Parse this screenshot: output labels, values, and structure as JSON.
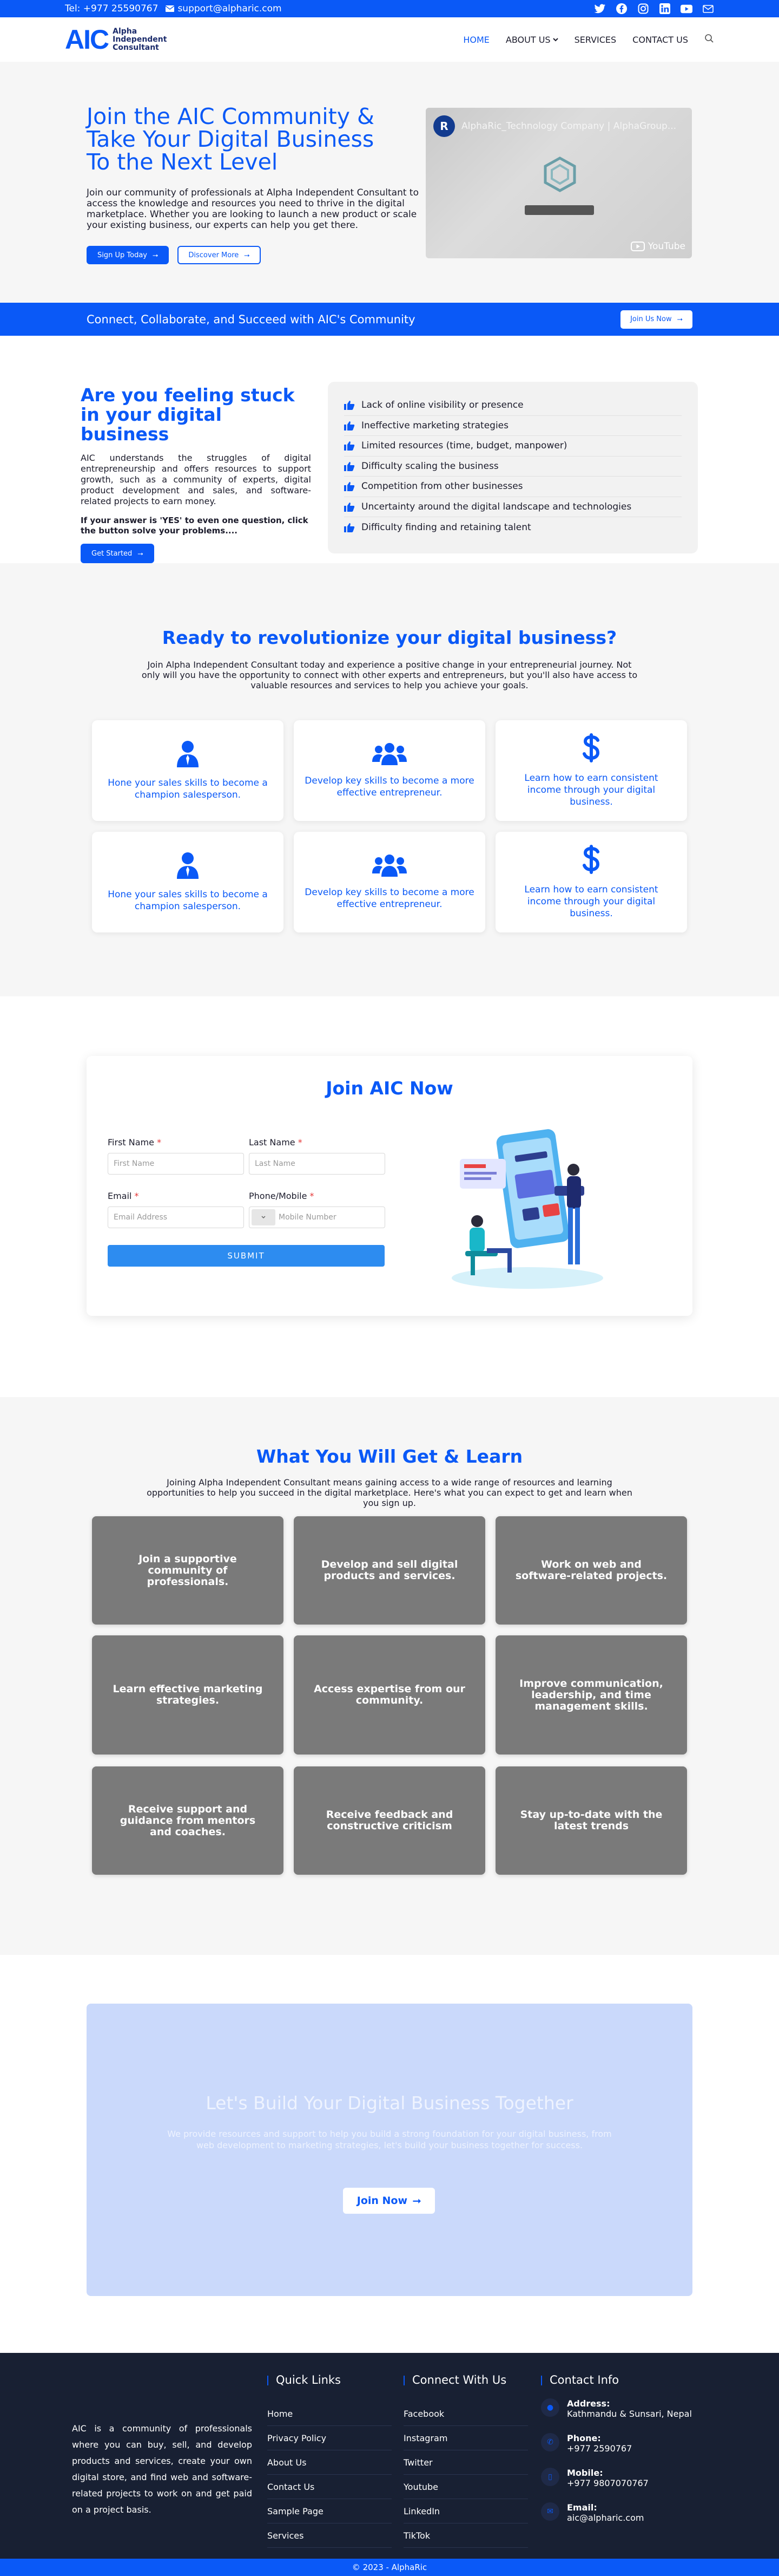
{
  "topbar": {
    "phone": "Tel: +977 25590767",
    "email": "support@alpharic.com",
    "socials": [
      "twitter-icon",
      "facebook-icon",
      "instagram-icon",
      "linkedin-icon",
      "youtube-icon",
      "mail-icon"
    ]
  },
  "header": {
    "logo_mark": "AIC",
    "logo_text": [
      "Alpha",
      "Independent",
      "Consultant"
    ],
    "nav": [
      {
        "label": "HOME",
        "active": true
      },
      {
        "label": "ABOUT US",
        "dropdown": true
      },
      {
        "label": "SERVICES"
      },
      {
        "label": "CONTACT US"
      }
    ]
  },
  "hero": {
    "title": "Join the AIC Community & Take Your Digital Business To the Next Level",
    "text": "Join our community of professionals at Alpha Independent Consultant to access the knowledge and resources you need to thrive in the digital marketplace. Whether you are looking to launch a new product or scale your existing business, our experts can help you get there.",
    "btn_signup": "Sign Up Today",
    "btn_discover": "Discover More",
    "video_title": "AlphaRic_Technology Company | AlphaGroup...",
    "video_channel": "R",
    "video_platform": "YouTube"
  },
  "banner": {
    "text": "Connect, Collaborate, and Succeed with AIC's Community",
    "button": "Join Us Now"
  },
  "stuck": {
    "title": "Are you feeling stuck in your digital business",
    "desc": "AIC understands the struggles of digital entrepreneurship and offers resources to support growth, such as a community of experts, digital product development and sales, and software-related projects to earn money.",
    "question": "If your answer is 'YES' to even one question, click the button solve your problems....",
    "button": "Get Started",
    "items": [
      "Lack of online visibility or presence",
      "Ineffective marketing strategies",
      "Limited resources (time, budget, manpower)",
      "Difficulty scaling the business",
      "Competition from other businesses",
      "Uncertainty around the digital landscape and technologies",
      "Difficulty finding and retaining talent"
    ]
  },
  "ready": {
    "title": "Ready to revolutionize your digital business?",
    "sub": "Join Alpha Independent Consultant today and experience a positive change in your entrepreneurial journey. Not only will you have the opportunity to connect with other experts and entrepreneurs, but you'll also have access to valuable resources and services to help you achieve your goals.",
    "cards": [
      {
        "icon": "user-icon",
        "text": "Hone your sales skills to become a champion salesperson."
      },
      {
        "icon": "users-icon",
        "text": "Develop key skills to become a more effective entrepreneur."
      },
      {
        "icon": "dollar-icon",
        "text": "Learn how to earn consistent income through your digital business."
      },
      {
        "icon": "user-icon",
        "text": "Hone your sales skills to become a champion salesperson."
      },
      {
        "icon": "users-icon",
        "text": "Develop key skills to become a more effective entrepreneur."
      },
      {
        "icon": "dollar-icon",
        "text": "Learn how to earn consistent income through your digital business."
      }
    ]
  },
  "join": {
    "title": "Join AIC Now",
    "first_name_label": "First Name",
    "first_name_placeholder": "First Name",
    "last_name_label": "Last Name",
    "last_name_placeholder": "Last Name",
    "email_label": "Email",
    "email_placeholder": "Email Address",
    "phone_label": "Phone/Mobile",
    "phone_placeholder": "Mobile Number",
    "submit": "SUBMIT",
    "required_mark": "*"
  },
  "learn": {
    "title": "What You Will Get & Learn",
    "sub": "Joining Alpha Independent Consultant means gaining access to a wide range of resources and learning opportunities to help you succeed in the digital marketplace. Here's what you can expect to get and learn when you sign up.",
    "tiles": [
      "Join a supportive community of professionals.",
      "Develop and sell digital products and services.",
      "Work on web and software-related projects.",
      "Learn effective marketing strategies.",
      "Access expertise from our community.",
      "Improve communication, leadership, and time management skills.",
      "Receive support and guidance from mentors and coaches.",
      "Receive feedback and constructive criticism",
      "Stay up-to-date with the latest trends"
    ]
  },
  "cta": {
    "title": "Let's Build Your Digital Business Together",
    "text": "We provide resources and support to help you build a strong foundation for your digital business, from web development to marketing strategies, let's build your business together for success.",
    "button": "Join Now"
  },
  "footer": {
    "about": "AIC is a community of professionals where you can buy, sell, and develop products and services, create your own digital store, and find web and software-related projects to work on and get paid on a project basis.",
    "quick_title": "Quick Links",
    "quick_links": [
      "Home",
      "Privacy Policy",
      "About Us",
      "Contact Us",
      "Sample Page",
      "Services"
    ],
    "connect_title": "Connect With Us",
    "connect_links": [
      "Facebook",
      "Instagram",
      "Twitter",
      "Youtube",
      "LinkedIn",
      "TikTok"
    ],
    "info_title": "Contact Info",
    "info": [
      {
        "icon": "location-icon",
        "label": "Address:",
        "value": "Kathmandu & Sunsari, Nepal"
      },
      {
        "icon": "phone-icon",
        "label": "Phone:",
        "value": "+977 2590767"
      },
      {
        "icon": "mobile-icon",
        "label": "Mobile:",
        "value": "+977 9807070767"
      },
      {
        "icon": "mail-icon",
        "label": "Email:",
        "value": "aic@alpharic.com"
      }
    ],
    "copyright": "© 2023 - AlphaRic"
  },
  "colors": {
    "brand": "#0a59f7",
    "footer_bg": "#182033",
    "tile_bg": "#7a7a7a"
  }
}
